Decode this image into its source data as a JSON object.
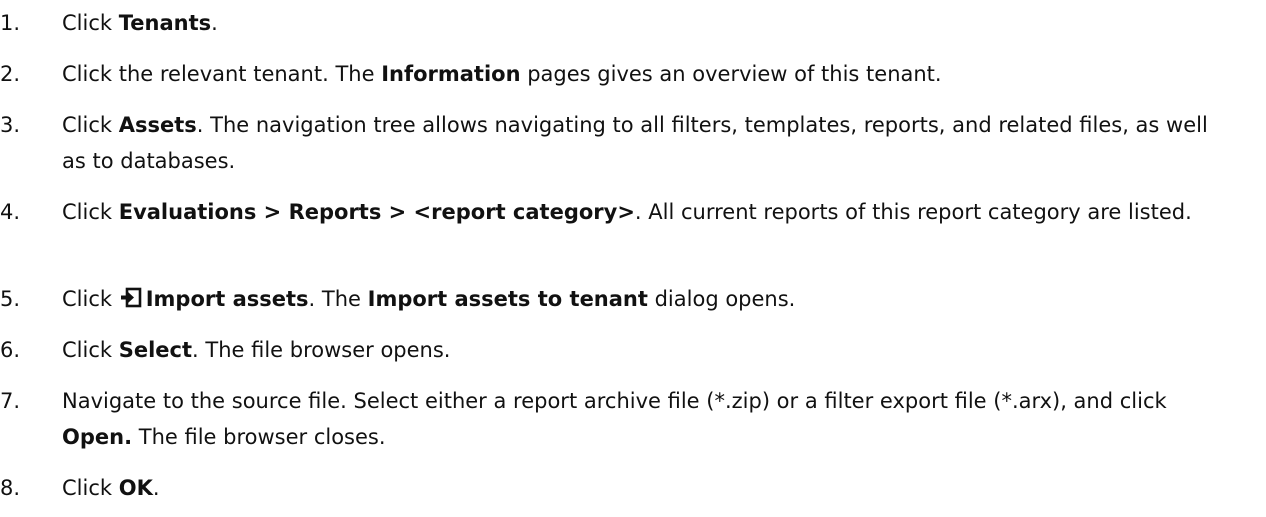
{
  "steps": [
    {
      "number": "1.",
      "parts": {
        "a": "Click ",
        "b1": "Tenants",
        "c": "."
      }
    },
    {
      "number": "2.",
      "parts": {
        "a": "Click the relevant tenant. The ",
        "b1": "Information",
        "c": " pages gives an overview of this tenant."
      }
    },
    {
      "number": "3.",
      "parts": {
        "a": "Click ",
        "b1": "Assets",
        "c": ". The navigation tree allows navigating to all filters, templates, reports, and related files, as well as to databases."
      }
    },
    {
      "number": "4.",
      "parts": {
        "a": "Click ",
        "b1": "Evaluations > Reports > <report category>",
        "c": ". All current reports of this report category are listed."
      }
    },
    {
      "number": "5.",
      "icon": "import-assets-icon",
      "parts": {
        "a": "Click ",
        "b1": "Import assets",
        "c": ". The ",
        "b2": "Import assets to tenant",
        "d": " dialog opens."
      }
    },
    {
      "number": "6.",
      "parts": {
        "a": "Click ",
        "b1": "Select",
        "c": ". The file browser opens."
      }
    },
    {
      "number": "7.",
      "parts": {
        "a": "Navigate to the source file. Select either a report archive file (*.zip) or a filter export file (*.arx), and click ",
        "b1": "Open.",
        "c": " The file browser closes."
      }
    },
    {
      "number": "8.",
      "parts": {
        "a": "Click ",
        "b1": "OK",
        "c": "."
      }
    }
  ]
}
